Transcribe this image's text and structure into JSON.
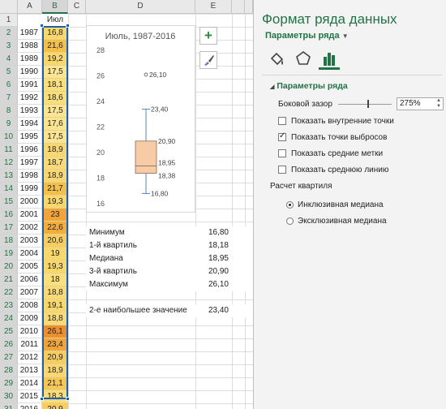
{
  "columns": [
    "A",
    "B",
    "C",
    "D",
    "E"
  ],
  "rows": [
    "1",
    "2",
    "3",
    "4",
    "5",
    "6",
    "7",
    "8",
    "9",
    "10",
    "11",
    "12",
    "13",
    "14",
    "15",
    "16",
    "17",
    "18",
    "19",
    "20",
    "21",
    "22",
    "23",
    "24",
    "25",
    "26",
    "27",
    "28",
    "29",
    "30",
    "31"
  ],
  "header_cell": "Июл",
  "years": [
    "1987",
    "1988",
    "1989",
    "1990",
    "1991",
    "1992",
    "1993",
    "1994",
    "1995",
    "1996",
    "1997",
    "1998",
    "1999",
    "2000",
    "2001",
    "2002",
    "2003",
    "2004",
    "2005",
    "2006",
    "2007",
    "2008",
    "2009",
    "2010",
    "2011",
    "2012",
    "2013",
    "2014",
    "2015",
    "2016"
  ],
  "july": [
    "16,8",
    "21,6",
    "19,2",
    "17,5",
    "18,1",
    "18,6",
    "17,5",
    "17,6",
    "17,5",
    "18,9",
    "18,7",
    "18,9",
    "21,7",
    "19,3",
    "23",
    "22,6",
    "20,6",
    "19",
    "19,3",
    "18",
    "18,8",
    "19,1",
    "18,8",
    "26,1",
    "23,4",
    "20,9",
    "18,9",
    "21,1",
    "18,3",
    "20,9"
  ],
  "cell_colors": [
    "#f8d86c",
    "#f5c04a",
    "#f8d86c",
    "#fbe592",
    "#f9df7d",
    "#f9de7b",
    "#fbe592",
    "#fbe490",
    "#fbe592",
    "#f9d873",
    "#f9da78",
    "#f9d873",
    "#f5c04a",
    "#f8d86c",
    "#f0a43a",
    "#f2ad3d",
    "#f6cd5e",
    "#f8d86c",
    "#f8d86c",
    "#f9df7d",
    "#f9da78",
    "#f8d86c",
    "#f9da78",
    "#ec8f30",
    "#f0a43a",
    "#f6cd5e",
    "#f9d873",
    "#f6c757",
    "#f9dd7b",
    "#f6cd5e"
  ],
  "stats": [
    {
      "label": "Минимум",
      "value": "16,80"
    },
    {
      "label": "1-й квартиль",
      "value": "18,18"
    },
    {
      "label": "Медиана",
      "value": "18,95"
    },
    {
      "label": "3-й квартиль",
      "value": "20,90"
    },
    {
      "label": "Максимум",
      "value": "26,10"
    },
    {
      "label": "2-е наибольшее значение",
      "value": "23,40"
    }
  ],
  "chart_data": {
    "type": "boxplot",
    "title": "Июль, 1987-2016",
    "ylim": [
      16,
      28
    ],
    "yticks": [
      16,
      18,
      20,
      22,
      24,
      26,
      28
    ],
    "min": 16.8,
    "q1": 18.38,
    "median": 18.95,
    "q3": 20.9,
    "whisker_max": 23.4,
    "outlier": 26.1,
    "labels": {
      "outlier": "26,10",
      "whisker_max": "23,40",
      "q3": "20,90",
      "median": "18,95",
      "q1": "18,38",
      "min": "16,80"
    },
    "box_color": "#f8cba7",
    "whisker_color": "#4a88c2"
  },
  "pane": {
    "title": "Формат ряда данных",
    "subtitle": "Параметры ряда",
    "section": "Параметры ряда",
    "gap_label": "Боковой зазор",
    "gap_value": "275%",
    "options": [
      {
        "label": "Показать внутренние точки",
        "checked": false
      },
      {
        "label": "Показать точки выбросов",
        "checked": true
      },
      {
        "label": "Показать средние метки",
        "checked": false
      },
      {
        "label": "Показать среднюю линию",
        "checked": false
      }
    ],
    "quartile_label": "Расчет квартиля",
    "radios": [
      {
        "label": "Инклюзивная медиана",
        "selected": true
      },
      {
        "label": "Эксклюзивная медиана",
        "selected": false
      }
    ],
    "accent": "#217346"
  }
}
